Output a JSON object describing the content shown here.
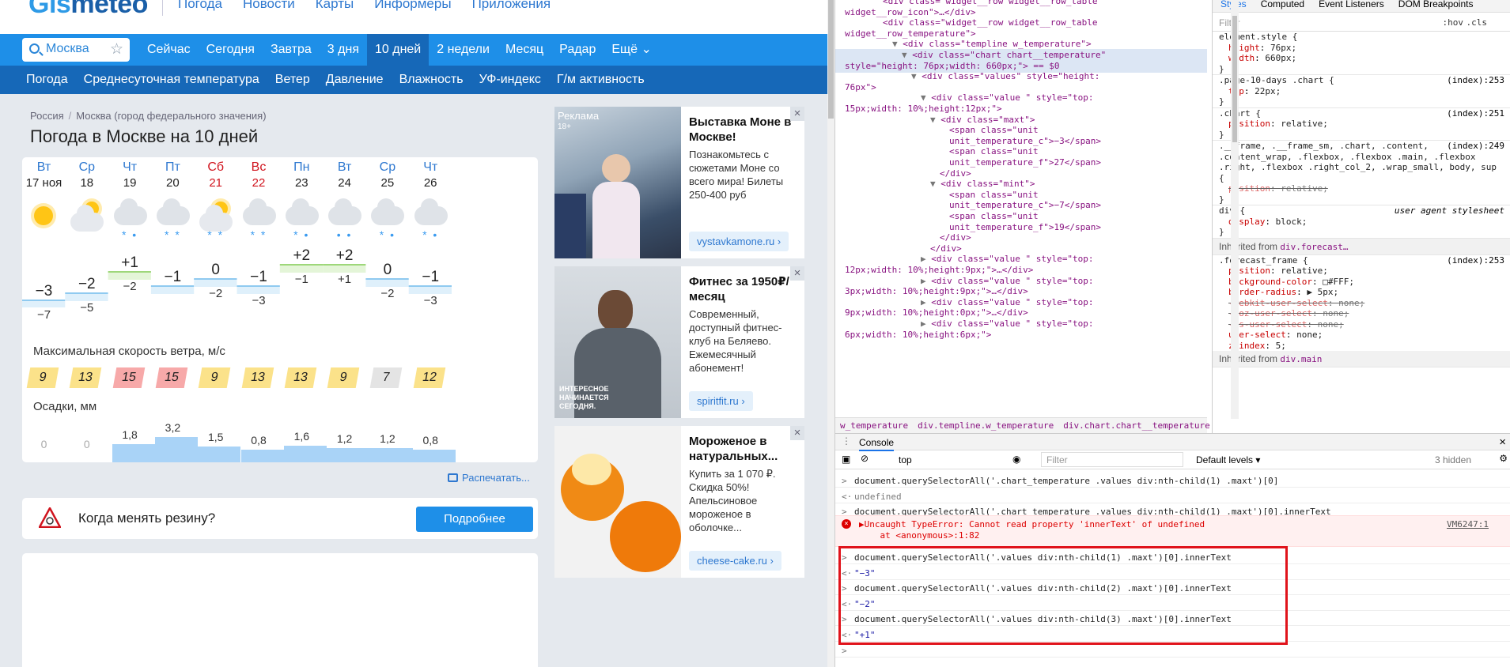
{
  "site": {
    "logo_main": "Gis",
    "logo_sub": "meteo",
    "top_links": [
      "Погода",
      "Новости",
      "Карты",
      "Информеры",
      "Приложения"
    ],
    "search": {
      "value": "Москва"
    },
    "nav_tabs": [
      "Сейчас",
      "Сегодня",
      "Завтра",
      "3 дня",
      "10 дней",
      "2 недели",
      "Месяц",
      "Радар",
      "Ещё ⌄"
    ],
    "active_tab": "10 дней",
    "sub_nav": [
      "Погода",
      "Среднесуточная температура",
      "Ветер",
      "Давление",
      "Влажность",
      "УФ-индекс",
      "Г/м активность"
    ],
    "breadcrumb": [
      "Россия",
      "Москва (город федерального значения)"
    ],
    "title": "Погода в Москве на 10 дней",
    "days": [
      {
        "name": "Вт",
        "date": "17 ноя",
        "weekend": false,
        "icon": "sun-icon",
        "tmax": "−3",
        "tmin": "−7",
        "wind": "9",
        "precip": "0"
      },
      {
        "name": "Ср",
        "date": "18",
        "weekend": false,
        "icon": "partly-cloudy-icon",
        "tmax": "−2",
        "tmin": "−5",
        "wind": "13",
        "precip": "0"
      },
      {
        "name": "Чт",
        "date": "19",
        "weekend": false,
        "icon": "cloud-snow-rain-icon",
        "tmax": "+1",
        "tmin": "−2",
        "wind": "15",
        "precip": "1,8"
      },
      {
        "name": "Пт",
        "date": "20",
        "weekend": false,
        "icon": "cloud-snow-icon",
        "tmax": "−1",
        "tmin": "",
        "wind": "15",
        "precip": "3,2"
      },
      {
        "name": "Сб",
        "date": "21",
        "weekend": true,
        "icon": "partly-cloudy-snow-icon",
        "tmax": "0",
        "tmin": "−2",
        "wind": "9",
        "precip": "1,5"
      },
      {
        "name": "Вс",
        "date": "22",
        "weekend": true,
        "icon": "cloud-snow-icon",
        "tmax": "−1",
        "tmin": "−3",
        "wind": "13",
        "precip": "0,8"
      },
      {
        "name": "Пн",
        "date": "23",
        "weekend": false,
        "icon": "cloud-snow-rain-icon",
        "tmax": "+2",
        "tmin": "−1",
        "wind": "13",
        "precip": "1,6"
      },
      {
        "name": "Вт",
        "date": "24",
        "weekend": false,
        "icon": "cloud-rain-icon",
        "tmax": "+2",
        "tmin": "+1",
        "wind": "9",
        "precip": "1,2"
      },
      {
        "name": "Ср",
        "date": "25",
        "weekend": false,
        "icon": "cloud-snow-rain-icon",
        "tmax": "0",
        "tmin": "−2",
        "wind": "7",
        "precip": "1,2"
      },
      {
        "name": "Чт",
        "date": "26",
        "weekend": false,
        "icon": "cloud-snow-rain-icon",
        "tmax": "−1",
        "tmin": "−3",
        "wind": "12",
        "precip": "0,8"
      }
    ],
    "chart_data": {
      "type": "line",
      "x": [
        "17 ноя",
        "18",
        "19",
        "20",
        "21",
        "22",
        "23",
        "24",
        "25",
        "26"
      ],
      "series": [
        {
          "name": "max",
          "values": [
            -3,
            -2,
            1,
            -1,
            0,
            -1,
            2,
            2,
            0,
            -1
          ]
        },
        {
          "name": "min",
          "values": [
            -7,
            -5,
            -2,
            null,
            -2,
            -3,
            -1,
            1,
            -2,
            -3
          ]
        }
      ],
      "precip_mm": [
        0,
        0,
        1.8,
        3.2,
        1.5,
        0.8,
        1.6,
        1.2,
        1.2,
        0.8
      ],
      "wind_ms": [
        9,
        13,
        15,
        15,
        9,
        13,
        13,
        9,
        7,
        12
      ]
    },
    "wind_label": "Максимальная скорость ветра, м/с",
    "precip_label": "Осадки, мм",
    "print_label": "Распечатать...",
    "tire": {
      "text": "Когда менять резину?",
      "button": "Подробнее"
    },
    "ads": [
      {
        "label": "Реклама",
        "badge": "18+",
        "title": "Выставка Моне в Москве!",
        "desc": "Познакомьтесь с сюжетами Моне со всего мира! Билеты 250-400 руб",
        "link": "vystavkamone.ru ›"
      },
      {
        "title": "Фитнес за 1950₽/месяц",
        "desc": "Современный, доступный фитнес-клуб на Беляево. Ежемесячный абонемент!",
        "img_text": "ИНТЕРЕСНОЕ НАЧИНАЕТСЯ СЕГОДНЯ.",
        "link": "spiritfit.ru ›"
      },
      {
        "title": "Мороженое в натуральных...",
        "desc": "Купить за 1 070 ₽. Скидка 50%! Апельсиновое мороженое в оболочке...",
        "link": "cheese-cake.ru ›"
      }
    ]
  },
  "devtools": {
    "dom_lines": [
      {
        "indent": 10,
        "tri": "",
        "html": "<div class=\"widget__row widget__row_table"
      },
      {
        "indent": 0,
        "tri": "",
        "html": "widget__row_icon\">…</div>"
      },
      {
        "indent": 10,
        "tri": "",
        "html": "<div class=\"widget__row widget__row_table"
      },
      {
        "indent": 0,
        "tri": "",
        "html": "widget__row_temperature\">"
      },
      {
        "indent": 12,
        "tri": "▼",
        "html": "<div class=\"templine w_temperature\">"
      },
      {
        "indent": 14,
        "tri": "▼",
        "html": "<div class=\"chart chart__temperature\""
      },
      {
        "indent": 0,
        "tri": "",
        "html": "style=\"height: 76px;width: 660px;\"> == $0"
      },
      {
        "indent": 16,
        "tri": "▼",
        "html": "<div class=\"values\" style=\"height:"
      },
      {
        "indent": 0,
        "tri": "",
        "html": "76px\">"
      },
      {
        "indent": 18,
        "tri": "▼",
        "html": "<div class=\"value \" style=\"top:"
      },
      {
        "indent": 0,
        "tri": "",
        "html": "15px;width: 10%;height:12px;\">"
      },
      {
        "indent": 20,
        "tri": "▼",
        "html": "<div class=\"maxt\">"
      },
      {
        "indent": 24,
        "tri": "",
        "html": "<span class=\"unit"
      },
      {
        "indent": 24,
        "tri": "",
        "html": "unit_temperature_c\">−3</span>"
      },
      {
        "indent": 24,
        "tri": "",
        "html": "<span class=\"unit"
      },
      {
        "indent": 24,
        "tri": "",
        "html": "unit_temperature_f\">27</span>"
      },
      {
        "indent": 22,
        "tri": "",
        "html": "</div>"
      },
      {
        "indent": 20,
        "tri": "▼",
        "html": "<div class=\"mint\">"
      },
      {
        "indent": 24,
        "tri": "",
        "html": "<span class=\"unit"
      },
      {
        "indent": 24,
        "tri": "",
        "html": "unit_temperature_c\">−7</span>"
      },
      {
        "indent": 24,
        "tri": "",
        "html": "<span class=\"unit"
      },
      {
        "indent": 24,
        "tri": "",
        "html": "unit_temperature_f\">19</span>"
      },
      {
        "indent": 22,
        "tri": "",
        "html": "</div>"
      },
      {
        "indent": 20,
        "tri": "",
        "html": "</div>"
      },
      {
        "indent": 18,
        "tri": "▶",
        "html": "<div class=\"value \" style=\"top:"
      },
      {
        "indent": 0,
        "tri": "",
        "html": "12px;width: 10%;height:9px;\">…</div>"
      },
      {
        "indent": 18,
        "tri": "▶",
        "html": "<div class=\"value \" style=\"top:"
      },
      {
        "indent": 0,
        "tri": "",
        "html": "3px;width: 10%;height:9px;\">…</div>"
      },
      {
        "indent": 18,
        "tri": "▶",
        "html": "<div class=\"value \" style=\"top:"
      },
      {
        "indent": 0,
        "tri": "",
        "html": "9px;width: 10%;height:0px;\">…</div>"
      },
      {
        "indent": 18,
        "tri": "▶",
        "html": "<div class=\"value \" style=\"top:"
      },
      {
        "indent": 0,
        "tri": "",
        "html": "6px;width: 10%;height:6px;\">"
      }
    ],
    "crumbs": [
      "w_temperature",
      "div.templine.w_temperature",
      "div.chart.chart__temperature"
    ],
    "style_tabs": [
      "Styles",
      "Computed",
      "Event Listeners",
      "DOM Breakpoints"
    ],
    "filter_placeholder": "Filter",
    "hov": ":hov",
    "cls": ".cls",
    "style_lines": [
      {
        "t": "sel",
        "text": "element.style {",
        "src": ""
      },
      {
        "t": "prop",
        "name": "height",
        "value": "76px;"
      },
      {
        "t": "prop",
        "name": "width",
        "value": "660px;"
      },
      {
        "t": "end",
        "text": "}"
      },
      {
        "t": "sel",
        "text": ".page-10-days .chart {",
        "src": "(index):253"
      },
      {
        "t": "prop",
        "name": "top",
        "value": "22px;"
      },
      {
        "t": "end",
        "text": "}"
      },
      {
        "t": "sel",
        "text": ".chart {",
        "src": "(index):251"
      },
      {
        "t": "prop",
        "name": "position",
        "value": "relative;"
      },
      {
        "t": "end",
        "text": "}"
      },
      {
        "t": "sel",
        "text": ".__frame, .__frame_sm, .chart, .content,",
        "src": "(index):249"
      },
      {
        "t": "sel",
        "text": ".content_wrap, .flexbox, .flexbox .main, .flexbox",
        "src": ""
      },
      {
        "t": "sel",
        "text": ".right, .flexbox .right_col_2, .wrap_small, body, sup",
        "src": ""
      },
      {
        "t": "sel",
        "text": "{",
        "src": ""
      },
      {
        "t": "strike",
        "name": "position",
        "value": "relative;"
      },
      {
        "t": "end",
        "text": "}"
      },
      {
        "t": "sel",
        "text": "div {",
        "src": "user agent stylesheet"
      },
      {
        "t": "prop",
        "name": "display",
        "value": "block;"
      },
      {
        "t": "end",
        "text": "}"
      }
    ],
    "inherited_1": "Inherited from",
    "inherited_1_el": "div.forecast…",
    "forecast_lines": [
      {
        "t": "sel",
        "text": ".forecast_frame {",
        "src": "(index):253"
      },
      {
        "t": "prop",
        "name": "position",
        "value": "relative;"
      },
      {
        "t": "prop",
        "name": "background-color",
        "value": "□#FFF;"
      },
      {
        "t": "prop",
        "name": "border-radius",
        "value": "▶ 5px;"
      },
      {
        "t": "strike",
        "name": "-webkit-user-select",
        "value": "none;"
      },
      {
        "t": "strike",
        "name": "-moz-user-select",
        "value": "none;"
      },
      {
        "t": "strike",
        "name": "-ms-user-select",
        "value": "none;"
      },
      {
        "t": "prop",
        "name": "user-select",
        "value": "none;"
      },
      {
        "t": "prop",
        "name": "z-index",
        "value": "5;"
      }
    ],
    "inherited_2": "Inherited from",
    "inherited_2_el": "div.main",
    "console_tab": "Console",
    "context": "top",
    "console_filter": "Filter",
    "levels": "Default levels ▾",
    "hidden": "3 hidden",
    "console_lines": [
      {
        "type": "in",
        "text": "document.querySelectorAll('.chart_temperature .values div:nth-child(1) .maxt')[0]"
      },
      {
        "type": "und",
        "text": "undefined"
      },
      {
        "type": "in",
        "text": "document.querySelectorAll('.chart_temperature .values div:nth-child(1) .maxt')[0].innerText"
      }
    ],
    "error": {
      "line1": "▶Uncaught TypeError: Cannot read property 'innerText' of undefined",
      "line2": "    at <anonymous>:1:82",
      "link": "VM6247:1"
    },
    "console_lines2": [
      {
        "type": "in",
        "text": "document.querySelectorAll('.values div:nth-child(1) .maxt')[0].innerText"
      },
      {
        "type": "str",
        "text": "\"−3\""
      },
      {
        "type": "in",
        "text": "document.querySelectorAll('.values div:nth-child(2) .maxt')[0].innerText"
      },
      {
        "type": "str",
        "text": "\"−2\""
      },
      {
        "type": "in",
        "text": "document.querySelectorAll('.values div:nth-child(3) .maxt')[0].innerText"
      },
      {
        "type": "str",
        "text": "\"+1\""
      },
      {
        "type": "in",
        "text": ""
      }
    ]
  }
}
